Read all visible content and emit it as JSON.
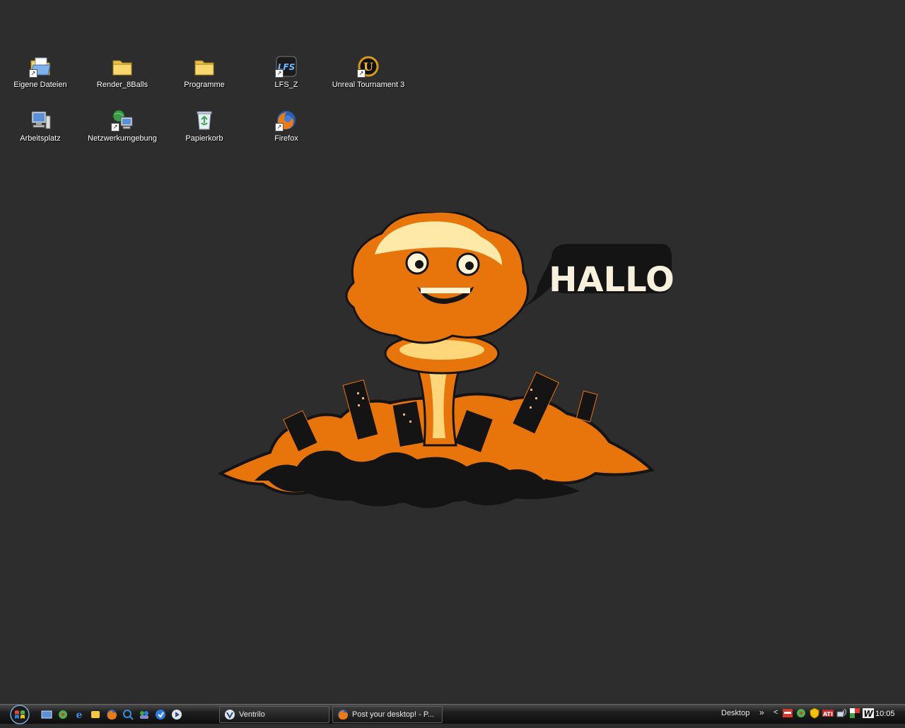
{
  "desktop": {
    "background_color": "#2d2d2d",
    "icons": [
      {
        "label": "Eigene Dateien",
        "icon": "my-documents-icon",
        "shortcut": true
      },
      {
        "label": "Render_8Balls",
        "icon": "folder-icon",
        "shortcut": false
      },
      {
        "label": "Programme",
        "icon": "folder-icon",
        "shortcut": false
      },
      {
        "label": "LFS_Z",
        "icon": "lfs-icon",
        "shortcut": true
      },
      {
        "label": "Unreal Tournament 3",
        "icon": "unreal-tournament-icon",
        "shortcut": true
      },
      {
        "label": "Arbeitsplatz",
        "icon": "my-computer-icon",
        "shortcut": false
      },
      {
        "label": "Netzwerkumgebung",
        "icon": "network-places-icon",
        "shortcut": true
      },
      {
        "label": "Papierkorb",
        "icon": "recycle-bin-icon",
        "shortcut": false
      },
      {
        "label": "Firefox",
        "icon": "firefox-icon",
        "shortcut": true
      }
    ]
  },
  "wallpaper": {
    "speech_bubble_text": "HALLO",
    "cloud_color": "#e8740c",
    "highlight_color": "#ffe9a8"
  },
  "taskbar": {
    "quick_launch": [
      "show-desktop-icon",
      "icq-icon",
      "internet-explorer-icon",
      "messenger-icon",
      "firefox-icon",
      "browser-icon",
      "msn-icon",
      "windows-update-icon",
      "media-player-icon"
    ],
    "tasks": [
      {
        "label": "Ventrilo",
        "icon": "ventrilo-icon"
      },
      {
        "label": "Post your desktop! - P...",
        "icon": "firefox-icon"
      }
    ],
    "toolbar_label": "Desktop",
    "toolbar_chevron": "»",
    "tray_arrow": "<",
    "tray_icons": [
      "antivirus-icon",
      "icq-tray-icon",
      "shield-icon",
      "ati-icon",
      "network-icon",
      "color-icon",
      "winamp-icon"
    ],
    "clock": "10:05"
  }
}
